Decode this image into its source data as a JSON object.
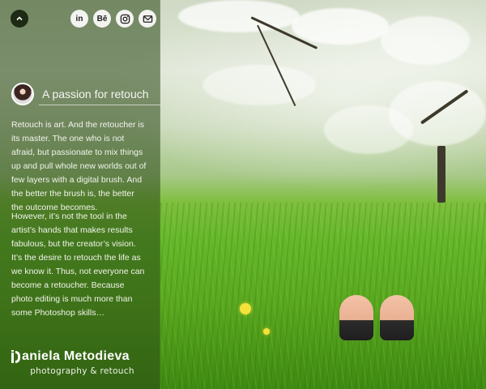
{
  "header": {
    "scroll_top_icon": "chevron-up-icon",
    "social_links": [
      {
        "name": "linkedin",
        "label": "in",
        "icon": "linkedin-icon"
      },
      {
        "name": "behance",
        "label": "Bē",
        "icon": "behance-icon"
      },
      {
        "name": "instagram",
        "label": "",
        "icon": "instagram-icon"
      },
      {
        "name": "email",
        "label": "",
        "icon": "mail-icon"
      }
    ]
  },
  "sidebar": {
    "heading": "A passion for retouch",
    "paragraph_1": "Retouch is art. And the retoucher is its master. The one who is not afraid, but passionate to mix things up and pull whole new worlds out of few layers with a digital brush. And the better the brush is, the better the outcome becomes.",
    "paragraph_2": "However, it’s not the tool in the artist’s hands that makes results fabulous, but the creator’s vision. It’s the desire to retouch the life as we know it. Thus, not everyone can become a retoucher. Because photo editing is much more than some Photoshop skills…"
  },
  "logo": {
    "name": "Daniela Metodieva",
    "tagline": "photography & retouch"
  },
  "colors": {
    "sidebar_overlay": "#28461499",
    "grass": "#65b82a",
    "text": "#f2f4ec"
  }
}
